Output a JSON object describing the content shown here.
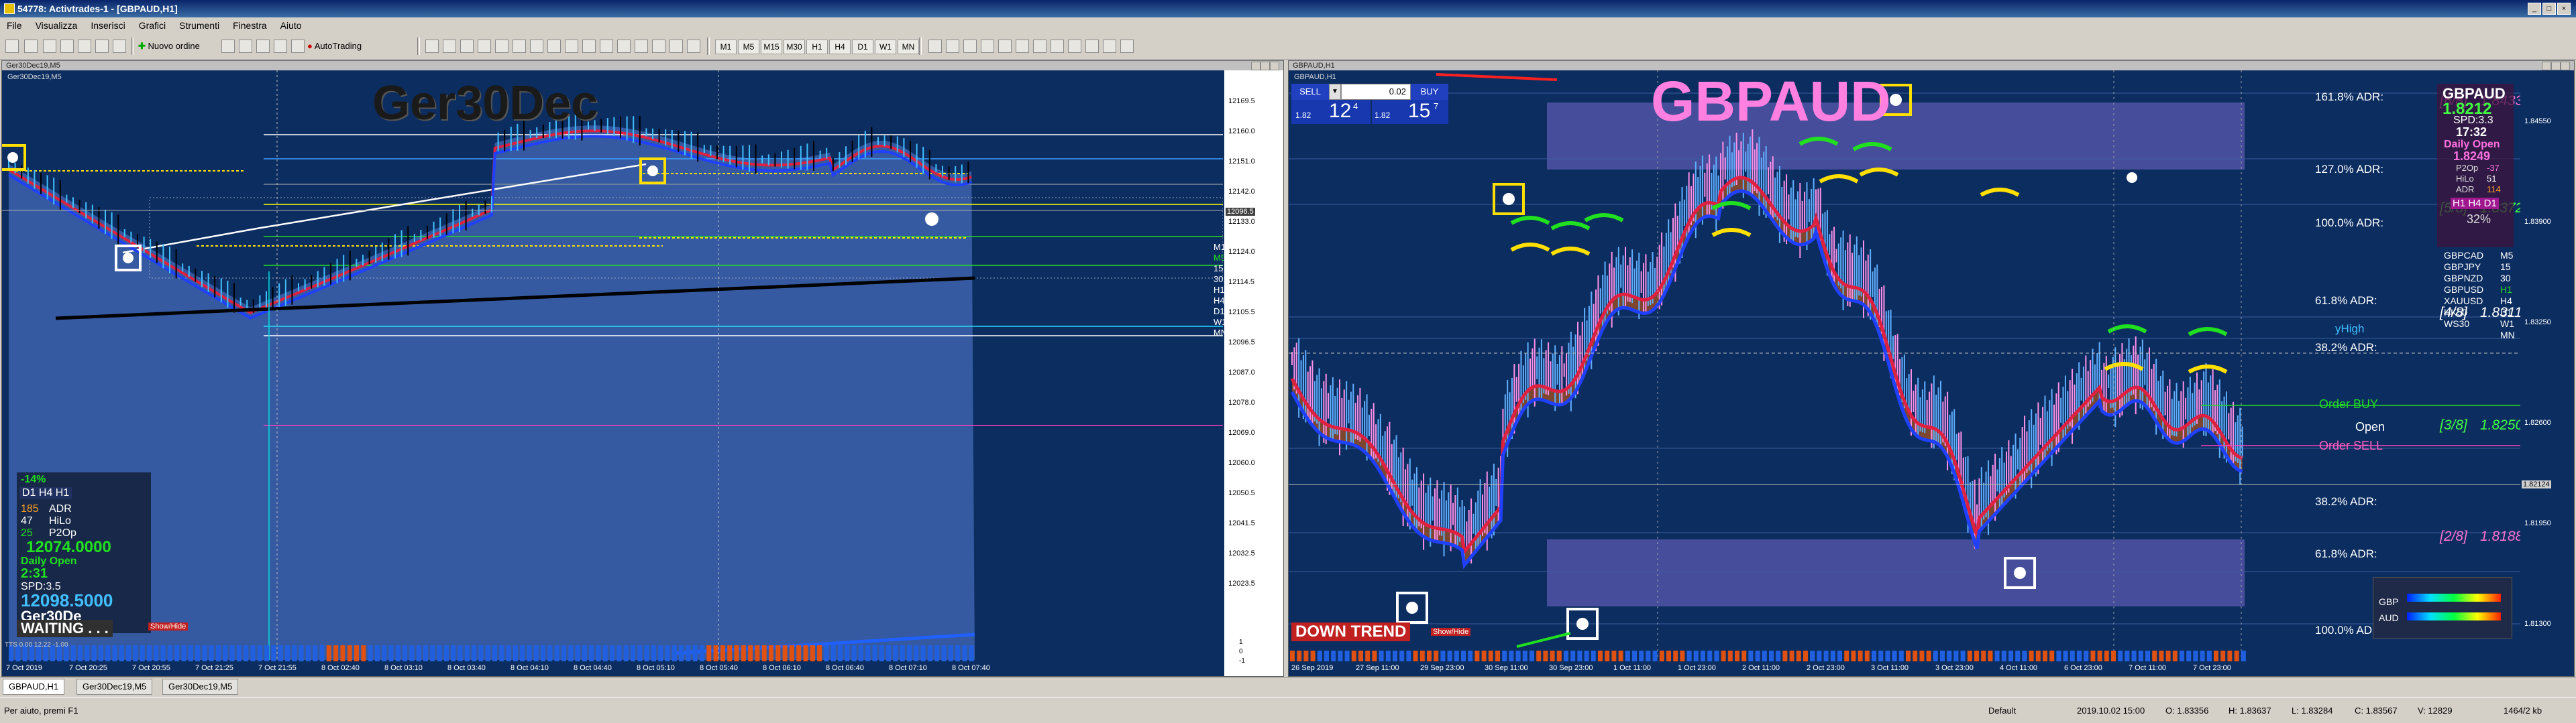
{
  "window": {
    "title": "54778: Activtrades-1 - [GBPAUD,H1]"
  },
  "menu": [
    "File",
    "Visualizza",
    "Inserisci",
    "Grafici",
    "Strumenti",
    "Finestra",
    "Aiuto"
  ],
  "toolbar": {
    "new_order": "Nuovo ordine",
    "autotrading": "AutoTrading",
    "timeframes": [
      "M1",
      "M5",
      "M15",
      "M30",
      "H1",
      "H4",
      "D1",
      "W1",
      "MN"
    ]
  },
  "chart_left": {
    "caption": "Ger30Dec19,M5",
    "symbol_label": "Ger30Dec19,M5",
    "watermark": "Ger30Dec",
    "price_scale": [
      "12169.5",
      "12160.0",
      "12151.0",
      "12142.0",
      "12133.0",
      "12124.0",
      "12114.5",
      "12105.5",
      "12096.5",
      "12087.0",
      "12078.0",
      "12069.0",
      "12060.0",
      "12050.5",
      "12041.5",
      "12032.5",
      "12023.5"
    ],
    "time_scale": [
      "7 Oct 2019",
      "7 Oct 20:25",
      "7 Oct 20:55",
      "7 Oct 21:25",
      "7 Oct 21:55",
      "8 Oct 02:40",
      "8 Oct 03:10",
      "8 Oct 03:40",
      "8 Oct 04:10",
      "8 Oct 04:40",
      "8 Oct 05:10",
      "8 Oct 05:40",
      "8 Oct 06:10",
      "8 Oct 06:40",
      "8 Oct 07:10",
      "8 Oct 07:40"
    ],
    "indicator_scale": [
      "1",
      "0",
      "-1"
    ],
    "indicator_label": "TTS 0.00 12.22 -1.00",
    "tf_list": [
      "M1",
      "M5",
      "15",
      "30",
      "H1",
      "H4",
      "D1",
      "W1",
      "MN"
    ],
    "current_price": "12096.5",
    "info_panel": {
      "adr_pct": "-14%",
      "tf_row": "D1  H4 H1",
      "rows": [
        [
          "185",
          "ADR"
        ],
        [
          "47",
          "HiLo"
        ],
        [
          "25",
          "P2Op"
        ]
      ],
      "daily_open_value": "12074.0000",
      "daily_open_label": "Daily Open",
      "time": "2:31",
      "spd": "SPD:3.5",
      "price": "12098.5000",
      "symbol": "Ger30De",
      "status": "WAITING . . .",
      "button": "Show/Hide"
    }
  },
  "chart_right": {
    "caption": "GBPAUD,H1",
    "symbol_label": "GBPAUD,H1",
    "watermark": "GBPAUD",
    "trade_panel": {
      "sell_label": "SELL",
      "buy_label": "BUY",
      "lot": "0.02",
      "sell_big": "12",
      "sell_small": "1.82",
      "sell_sup": "4",
      "buy_big": "15",
      "buy_small": "1.82",
      "buy_sup": "7"
    },
    "fib_levels": [
      "161.8% ADR:",
      "127.0% ADR:",
      "100.0% ADR:",
      "61.8% ADR:",
      "38.2% ADR:",
      "38.2% ADR:",
      "61.8% ADR:",
      "100.0% ADR:"
    ],
    "murrey": [
      {
        "label": "[6/8]",
        "value": "1.8433",
        "color": "#ff70d0"
      },
      {
        "label": "[5/8]",
        "value": "1.8372",
        "color": "#40ff40"
      },
      {
        "label": "[4/8]",
        "value": "1.8311",
        "color": "#ffffff"
      },
      {
        "label": "[3/8]",
        "value": "1.8250",
        "color": "#40ff40"
      },
      {
        "label": "[2/8]",
        "value": "1.8188",
        "color": "#ff70d0"
      }
    ],
    "order_labels": {
      "buy": "Order BUY",
      "open": "Open",
      "sell": "Order SELL",
      "yhigh": "yHigh"
    },
    "down_trend": "DOWN TREND",
    "show_hide": "Show/Hide",
    "info_box": {
      "symbol": "GBPAUD",
      "price": "1.8212",
      "spd": "SPD:3.3",
      "time": "17:32",
      "daily_open_label": "Daily Open",
      "daily_open": "1.8249",
      "rows": [
        [
          "P2Op",
          "-37"
        ],
        [
          "HiLo",
          "51"
        ],
        [
          "ADR",
          "114"
        ]
      ],
      "tf": "H1 H4 D1",
      "pct": "32%"
    },
    "pair_list": [
      [
        "GBPCAD",
        "M5"
      ],
      [
        "GBPJPY",
        "15"
      ],
      [
        "GBPNZD",
        "30"
      ],
      [
        "GBPUSD",
        "H1"
      ],
      [
        "XAUUSD",
        "H4"
      ],
      [
        "HK50",
        "D1"
      ],
      [
        "WS30",
        "W1"
      ],
      [
        "",
        "MN"
      ]
    ],
    "strength": {
      "a": "GBP",
      "b": "AUD"
    },
    "price_scale": [
      "1.84550",
      "1.83900",
      "1.83250",
      "1.82600",
      "1.81950",
      "1.81300"
    ],
    "time_scale": [
      "26 Sep 2019",
      "27 Sep 11:00",
      "29 Sep 23:00",
      "30 Sep 11:00",
      "30 Sep 23:00",
      "1 Oct 11:00",
      "1 Oct 23:00",
      "2 Oct 11:00",
      "2 Oct 23:00",
      "3 Oct 11:00",
      "3 Oct 23:00",
      "4 Oct 11:00",
      "6 Oct 23:00",
      "7 Oct 11:00",
      "7 Oct 23:00"
    ],
    "current_price": "1.82124"
  },
  "tabs": [
    "GBPAUD,H1",
    "Ger30Dec19,M5",
    "Ger30Dec19,M5"
  ],
  "status": {
    "help": "Per aiuto, premi F1",
    "profile": "Default",
    "datetime": "2019.10.02 15:00",
    "open": "O: 1.83356",
    "high": "H: 1.83637",
    "low": "L: 1.83284",
    "close": "C: 1.83567",
    "volume": "V: 12829",
    "traffic": "1464/2 kb"
  },
  "colors": {
    "chart_bg": "#0c2d60",
    "chart_fill": "#3a5fa8",
    "bear_fill": "#8a4a2a",
    "ma_red": "#e02040",
    "ma_blue": "#2040ff",
    "accent_yellow": "#ffe000",
    "accent_green": "#20e020",
    "magenta": "#ff70e0"
  }
}
